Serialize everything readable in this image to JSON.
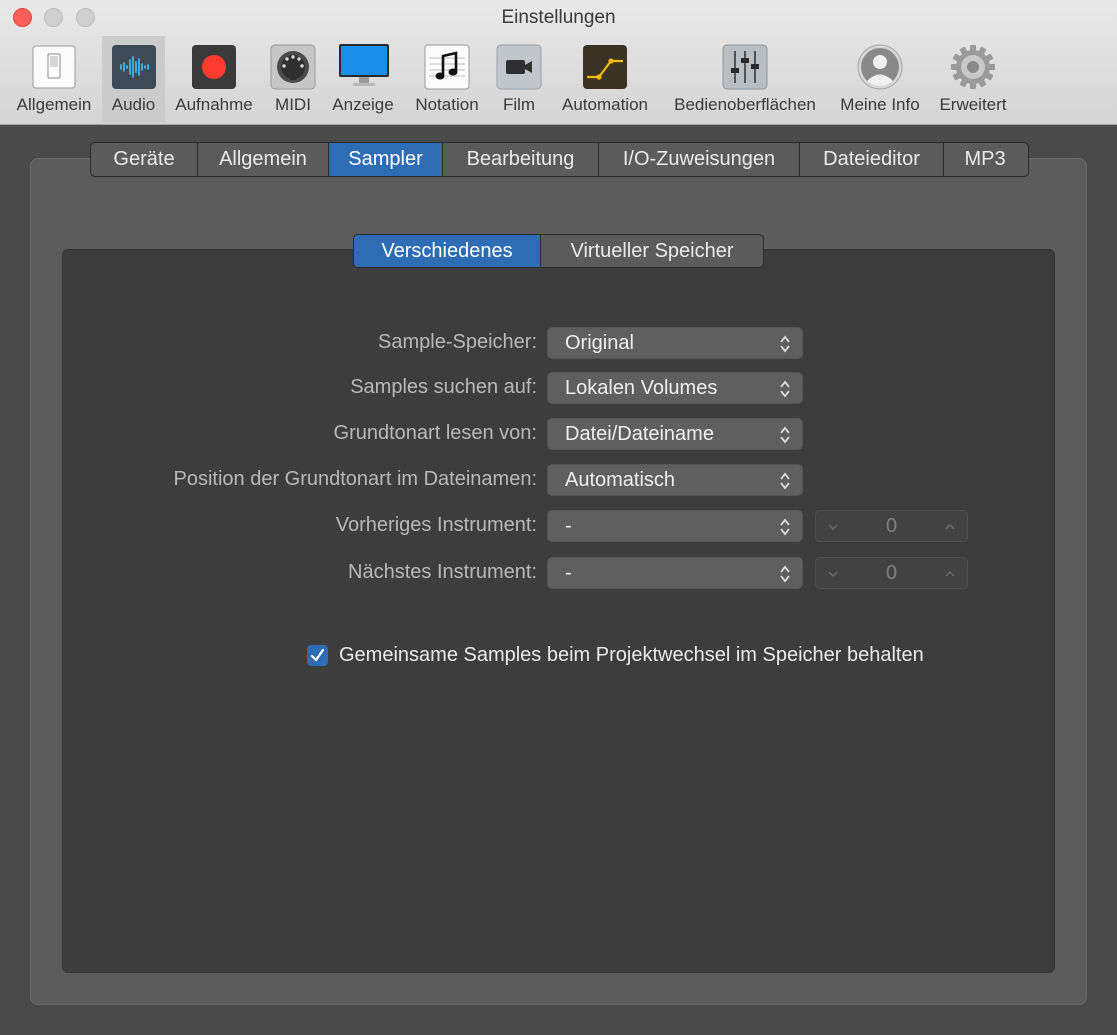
{
  "window": {
    "title": "Einstellungen"
  },
  "toolbar": {
    "items": [
      {
        "label": "Allgemein",
        "icon": "general-switch-icon"
      },
      {
        "label": "Audio",
        "icon": "audio-waveform-icon"
      },
      {
        "label": "Aufnahme",
        "icon": "record-icon"
      },
      {
        "label": "MIDI",
        "icon": "midi-connector-icon"
      },
      {
        "label": "Anzeige",
        "icon": "display-monitor-icon"
      },
      {
        "label": "Notation",
        "icon": "music-note-icon"
      },
      {
        "label": "Film",
        "icon": "video-camera-icon"
      },
      {
        "label": "Automation",
        "icon": "automation-curve-icon"
      },
      {
        "label": "Bedienoberflächen",
        "icon": "mixer-faders-icon"
      },
      {
        "label": "Meine Info",
        "icon": "user-silhouette-icon"
      },
      {
        "label": "Erweitert",
        "icon": "gear-icon"
      }
    ],
    "selected": "Audio"
  },
  "tabs": {
    "items": [
      "Geräte",
      "Allgemein",
      "Sampler",
      "Bearbeitung",
      "I/O-Zuweisungen",
      "Dateieditor",
      "MP3"
    ],
    "selected": "Sampler"
  },
  "subtabs": {
    "items": [
      "Verschiedenes",
      "Virtueller Speicher"
    ],
    "selected": "Verschiedenes"
  },
  "form": {
    "sample_memory": {
      "label": "Sample-Speicher:",
      "value": "Original"
    },
    "search_samples": {
      "label": "Samples suchen auf:",
      "value": "Lokalen Volumes"
    },
    "root_key_read": {
      "label": "Grundtonart lesen von:",
      "value": "Datei/Dateiname"
    },
    "root_key_position": {
      "label": "Position der Grundtonart im Dateinamen:",
      "value": "Automatisch"
    },
    "previous_instrument": {
      "label": "Vorheriges Instrument:",
      "value": "-",
      "stepper_value": "0"
    },
    "next_instrument": {
      "label": "Nächstes Instrument:",
      "value": "-",
      "stepper_value": "0"
    },
    "keep_samples": {
      "label": "Gemeinsame Samples beim Projektwechsel im Speicher behalten",
      "checked": true
    }
  },
  "colors": {
    "accent": "#2e6db4",
    "record_red": "#ff3b30",
    "automation_yellow": "#f5b800"
  }
}
